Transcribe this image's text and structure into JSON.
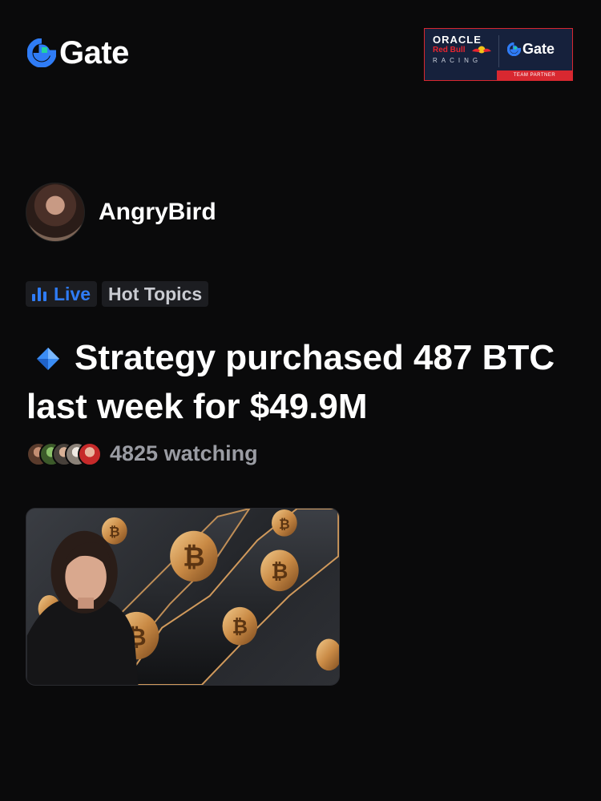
{
  "header": {
    "logo_text": "Gate",
    "logo_icon": "gate-logo-icon",
    "brand_color": "#2f7cf6",
    "partner_badge": {
      "line1": "ORACLE",
      "line2": "Red Bull",
      "line3": "RACING",
      "partner_name": "Gate",
      "partner_label": "TEAM PARTNER",
      "background": "#16213c",
      "accent": "#d82830"
    }
  },
  "post": {
    "author": {
      "name": "AngryBird",
      "avatar": "avatar-photo"
    },
    "tags": [
      {
        "label": "Live",
        "icon": "live-bars-icon",
        "color": "#2f7cf6"
      },
      {
        "label": "Hot Topics",
        "color": "#c9cbd1"
      }
    ],
    "title_icon": "blue-diamond-icon",
    "title": "Strategy purchased 487 BTC last week for $49.9M",
    "watching": {
      "count_text": "4825 watching",
      "viewer_avatars": 5
    },
    "thumbnail": {
      "description_icon": "bitcoin-coins-image"
    }
  }
}
